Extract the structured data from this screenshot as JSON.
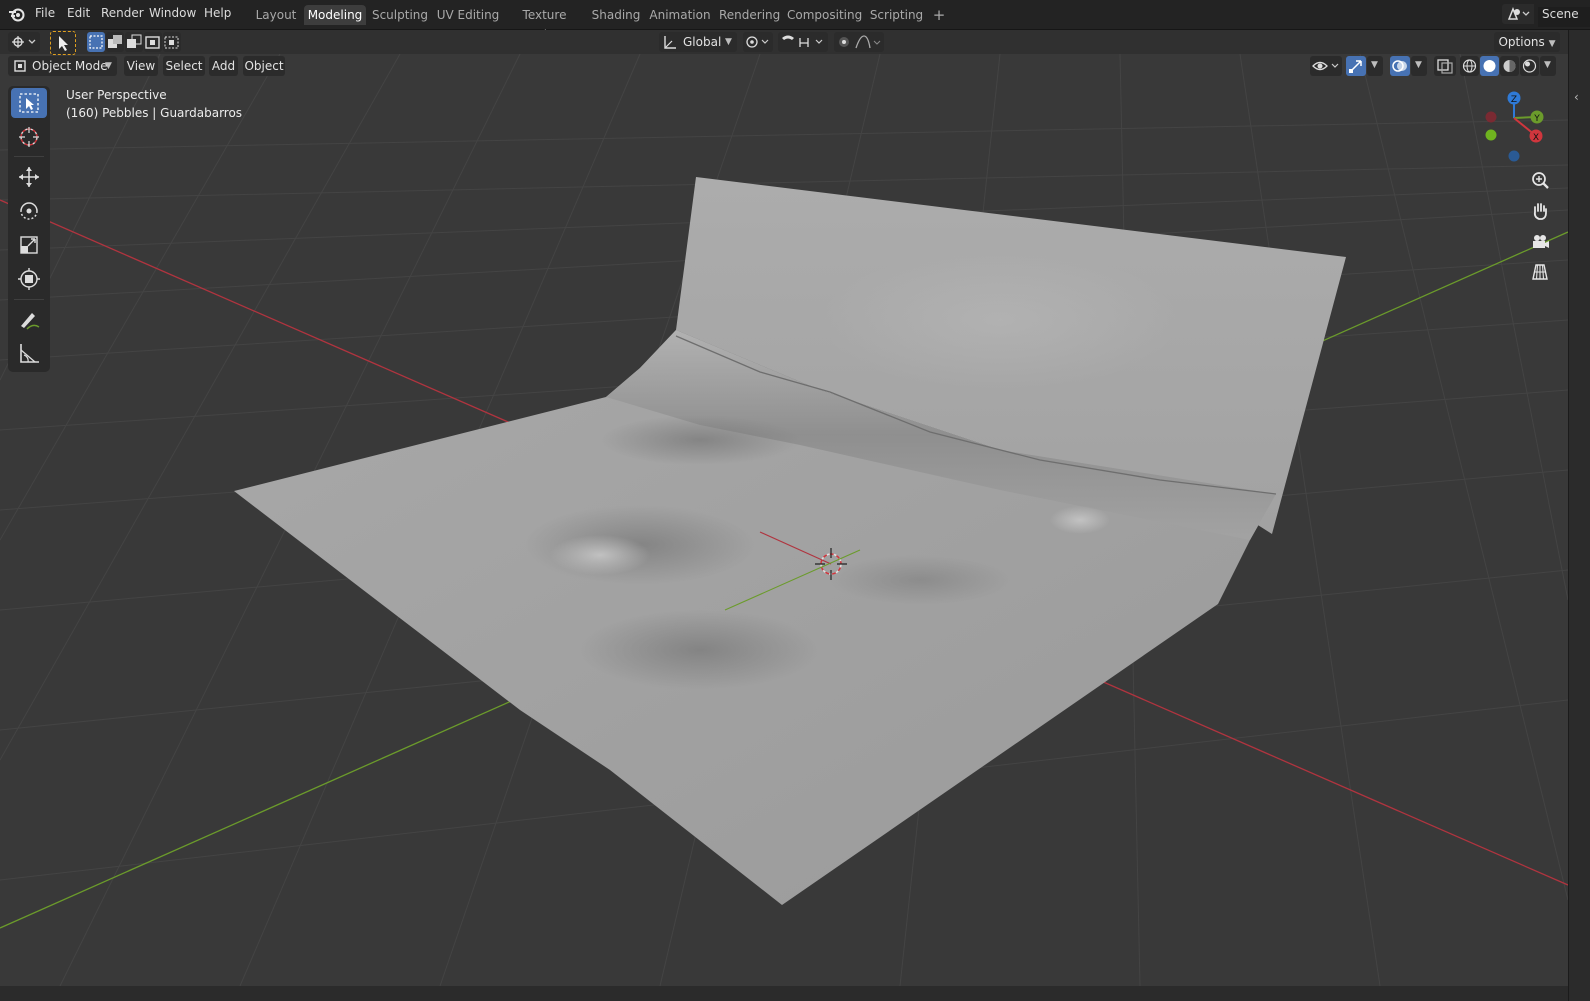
{
  "menu": {
    "items": [
      "File",
      "Edit",
      "Render",
      "Window",
      "Help"
    ]
  },
  "workspaces": {
    "tabs": [
      "Layout",
      "Modeling",
      "Sculpting",
      "UV Editing",
      "Texture Paint",
      "Shading",
      "Animation",
      "Rendering",
      "Compositing",
      "Scripting"
    ],
    "active": "Modeling",
    "add_label": "+"
  },
  "scene": {
    "label": "Scene"
  },
  "tool_header": {
    "orientation": "Global",
    "options_label": "Options"
  },
  "view_header": {
    "mode": "Object Mode",
    "menus": [
      "View",
      "Select",
      "Add",
      "Object"
    ]
  },
  "viewport": {
    "perspective_label": "User Perspective",
    "object_label": "(160) Pebbles | Guardabarros"
  },
  "gizmo": {
    "z_label": "Z",
    "y_label": "Y",
    "x_label": "X"
  },
  "colors": {
    "accent": "#4772b3",
    "x_axis": "#b0343f",
    "y_axis": "#6b9b2b",
    "z_axis": "#2f7ad7",
    "mesh": "#a4a4a4",
    "background": "#393939"
  },
  "icons": {
    "toolbar": [
      "select-box-icon",
      "cursor-icon",
      "move-icon",
      "rotate-icon",
      "scale-icon",
      "transform-icon",
      "annotate-icon",
      "measure-icon"
    ],
    "navigation": [
      "zoom-icon",
      "hand-icon",
      "camera-icon",
      "grid-icon"
    ]
  }
}
